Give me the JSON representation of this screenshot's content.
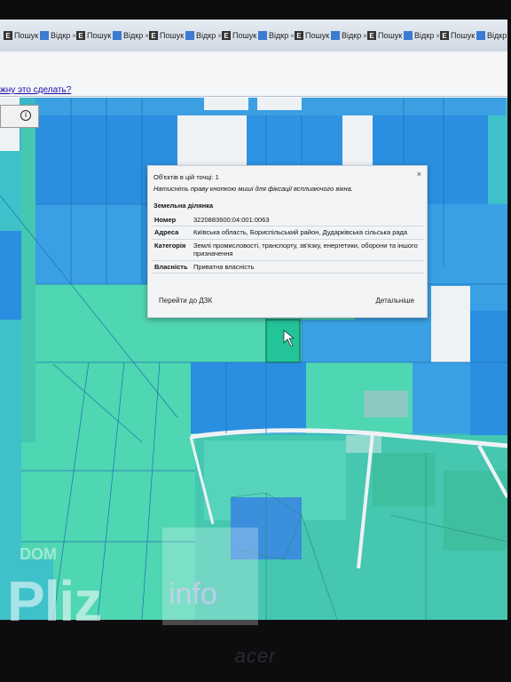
{
  "browser": {
    "tabs": [
      {
        "icon": "e",
        "label": "Пошук"
      },
      {
        "icon": "w",
        "label": "Відкр"
      },
      {
        "icon": "e",
        "label": "Пошук"
      },
      {
        "icon": "w",
        "label": "Відкр"
      },
      {
        "icon": "e",
        "label": "Пошук"
      },
      {
        "icon": "w",
        "label": "Відкр"
      },
      {
        "icon": "e",
        "label": "Пошук"
      },
      {
        "icon": "w",
        "label": "Відкр"
      },
      {
        "icon": "e",
        "label": "Пошук"
      },
      {
        "icon": "w",
        "label": "Відкр"
      },
      {
        "icon": "e",
        "label": "Пошук"
      },
      {
        "icon": "w",
        "label": "Відкр"
      },
      {
        "icon": "e",
        "label": "Пошук"
      },
      {
        "icon": "w",
        "label": "Відкр"
      }
    ]
  },
  "page": {
    "help_link": "жну это сделать?"
  },
  "popup": {
    "objects_count": "Об'єктів в цій точці: 1",
    "hint": "Натисніть праву кнопкою миші для фіксації всплиаючого вікна.",
    "section_title": "Земельна ділянка",
    "rows": [
      {
        "key": "Номер",
        "value": "3220883600:04:001:0063"
      },
      {
        "key": "Адреса",
        "value": "Київська область, Бориспільський район, Дударківська сільська рада"
      },
      {
        "key": "Категорія",
        "value": "Землі промисловості, транспорту, зв'язку, енергетики, оборони та іншого призначення"
      },
      {
        "key": "Власність",
        "value": "Приватна власність"
      }
    ],
    "goto_button": "Перейти до ДЗК",
    "details_button": "Детальніше",
    "close": "×"
  },
  "watermark": {
    "small": "DOM",
    "main": "Pliz",
    "suffix": "info"
  },
  "monitor": {
    "brand": "acer"
  },
  "colors": {
    "parcel_blue": "#1e7fd6",
    "parcel_cyan": "#3fc1c9",
    "parcel_green": "#4fd6b2",
    "parcel_white": "#eef2f5",
    "popup_bg": "#f2f4f6"
  }
}
